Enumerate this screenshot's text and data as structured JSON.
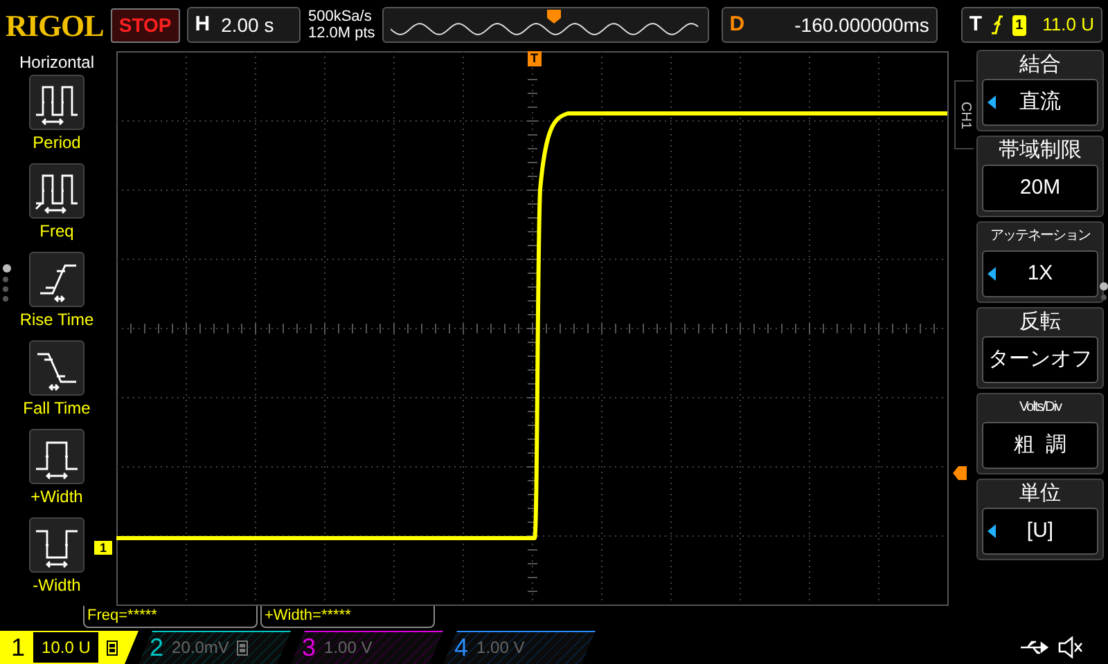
{
  "top_bar": {
    "brand": "RIGOL",
    "run_state": "STOP",
    "horizontal": {
      "label": "H",
      "timebase": "2.00 s"
    },
    "sample_rate": "500kSa/s",
    "memory_depth": "12.0M pts",
    "delay": {
      "label": "D",
      "value": "-160.000000ms"
    },
    "trigger": {
      "label": "T",
      "source": "1",
      "level": "11.0 U"
    }
  },
  "left_menu": {
    "title": "Horizontal",
    "items": [
      {
        "kind": "period",
        "label": "Period"
      },
      {
        "kind": "freq",
        "label": "Freq"
      },
      {
        "kind": "rise",
        "label": "Rise Time"
      },
      {
        "kind": "fall",
        "label": "Fall Time"
      },
      {
        "kind": "pwidth",
        "label": "+Width"
      },
      {
        "kind": "nwidth",
        "label": "-Width"
      }
    ],
    "pages": [
      {
        "selected": true
      },
      {
        "selected": false
      },
      {
        "selected": false
      },
      {
        "selected": false
      }
    ]
  },
  "screen": {
    "trigger_position_marker": "T",
    "channel_marker": "1"
  },
  "measurements": [
    "Freq=*****",
    "+Width=*****"
  ],
  "right_menu": {
    "channel_tab": "CH1",
    "items": [
      {
        "title": "結合",
        "value": "直流",
        "arrow": true
      },
      {
        "title": "帯域制限",
        "value": "20M",
        "arrow": false
      },
      {
        "title": "アッテネーション",
        "value": "1X",
        "arrow": true
      },
      {
        "title": "反転",
        "value": "ターンオフ",
        "arrow": false
      },
      {
        "title": "Volts/Div",
        "value": "粗  調",
        "arrow": false
      },
      {
        "title": "単位",
        "value": "[U]",
        "arrow": true
      }
    ],
    "pages": [
      {
        "selected": true
      },
      {
        "selected": false
      }
    ]
  },
  "channels": [
    {
      "number": "1",
      "scale": "10.0 U",
      "active": true,
      "bw_limit": true,
      "color": "#ffff00"
    },
    {
      "number": "2",
      "scale": "20.0mV",
      "active": false,
      "bw_limit": true,
      "color": "#00c8c8"
    },
    {
      "number": "3",
      "scale": "1.00 V",
      "active": false,
      "bw_limit": false,
      "color": "#e000e0"
    },
    {
      "number": "4",
      "scale": "1.00 V",
      "active": false,
      "bw_limit": false,
      "color": "#2a8cff"
    }
  ]
}
